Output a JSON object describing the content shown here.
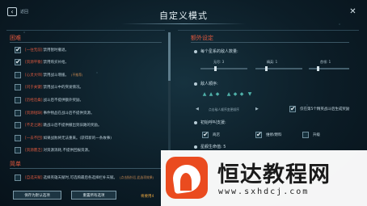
{
  "header": {
    "back_icon": "back-arrow-icon",
    "back_label": "返回",
    "title": "自定义模式",
    "close_icon": "close-icon"
  },
  "left": {
    "sec_hard": "困难",
    "hard_items": [
      {
        "tag": "[一往无前]",
        "desc": "禁用暂时撤退。",
        "checked": true
      },
      {
        "tag": "[资源平衡]",
        "desc": "禁用购买补给。",
        "checked": true
      },
      {
        "tag": "[心灵大师]",
        "desc": "禁用战斗增援。",
        "note": "(不推荐)",
        "checked": false
      },
      {
        "tag": "[闪于关键]",
        "desc": "禁用战斗中的突发情况。",
        "checked": false
      },
      {
        "tag": "[历经沧桑]",
        "desc": "战斗后不提供额外奖励。",
        "checked": false
      },
      {
        "tag": "[资源短缺]",
        "desc": "事件物品在战斗后不提供资源。",
        "checked": false
      },
      {
        "tag": "[不走之路]",
        "desc": "跳战斗后不提供撤出到旧路的奖励。",
        "checked": false
      },
      {
        "tag": "[一去不回]",
        "desc": "如果战败将无法重来。(获得新的一条故事)",
        "checked": false
      },
      {
        "tag": "[资源匮乏]",
        "desc": "对资源消耗,不提供回报资源。",
        "checked": false
      }
    ],
    "sec_easy": "简单",
    "easy_items": [
      {
        "tag": "[自选天赋]",
        "desc": "选择英雄天赋时,可选购最后各选择栏补天赋。",
        "note": "(点击指针后,此选项效果)",
        "checked": false
      }
    ],
    "btn_save": "保存为默认选项",
    "btn_reset": "重置所有选项",
    "note": "将要用4"
  },
  "right": {
    "sec_extra": "额外设定",
    "enemy_count_label": "每个星系的敌人数量:",
    "sliders": [
      {
        "label": "无尽: 3",
        "level": 0.3
      },
      {
        "label": "精英: 1",
        "level": 0.2
      },
      {
        "label": "首领: 1",
        "level": 0.2
      }
    ],
    "order_label": "敌人顺序:",
    "order_hint": "点击敌人顺序变更顺序",
    "boss_option": "仅在第5个精英战斗后生成奖励",
    "boss_checked": true,
    "support_label": "初始呼叫支援:",
    "support_opts": [
      {
        "label": "商店",
        "checked": true
      },
      {
        "label": "维修/燃料",
        "checked": true
      },
      {
        "label": "升级",
        "checked": false
      }
    ],
    "hp_label": "星舰生命值: 5"
  },
  "watermark": {
    "name": "恒达教程网",
    "url": "www.sxhdcj.com"
  }
}
